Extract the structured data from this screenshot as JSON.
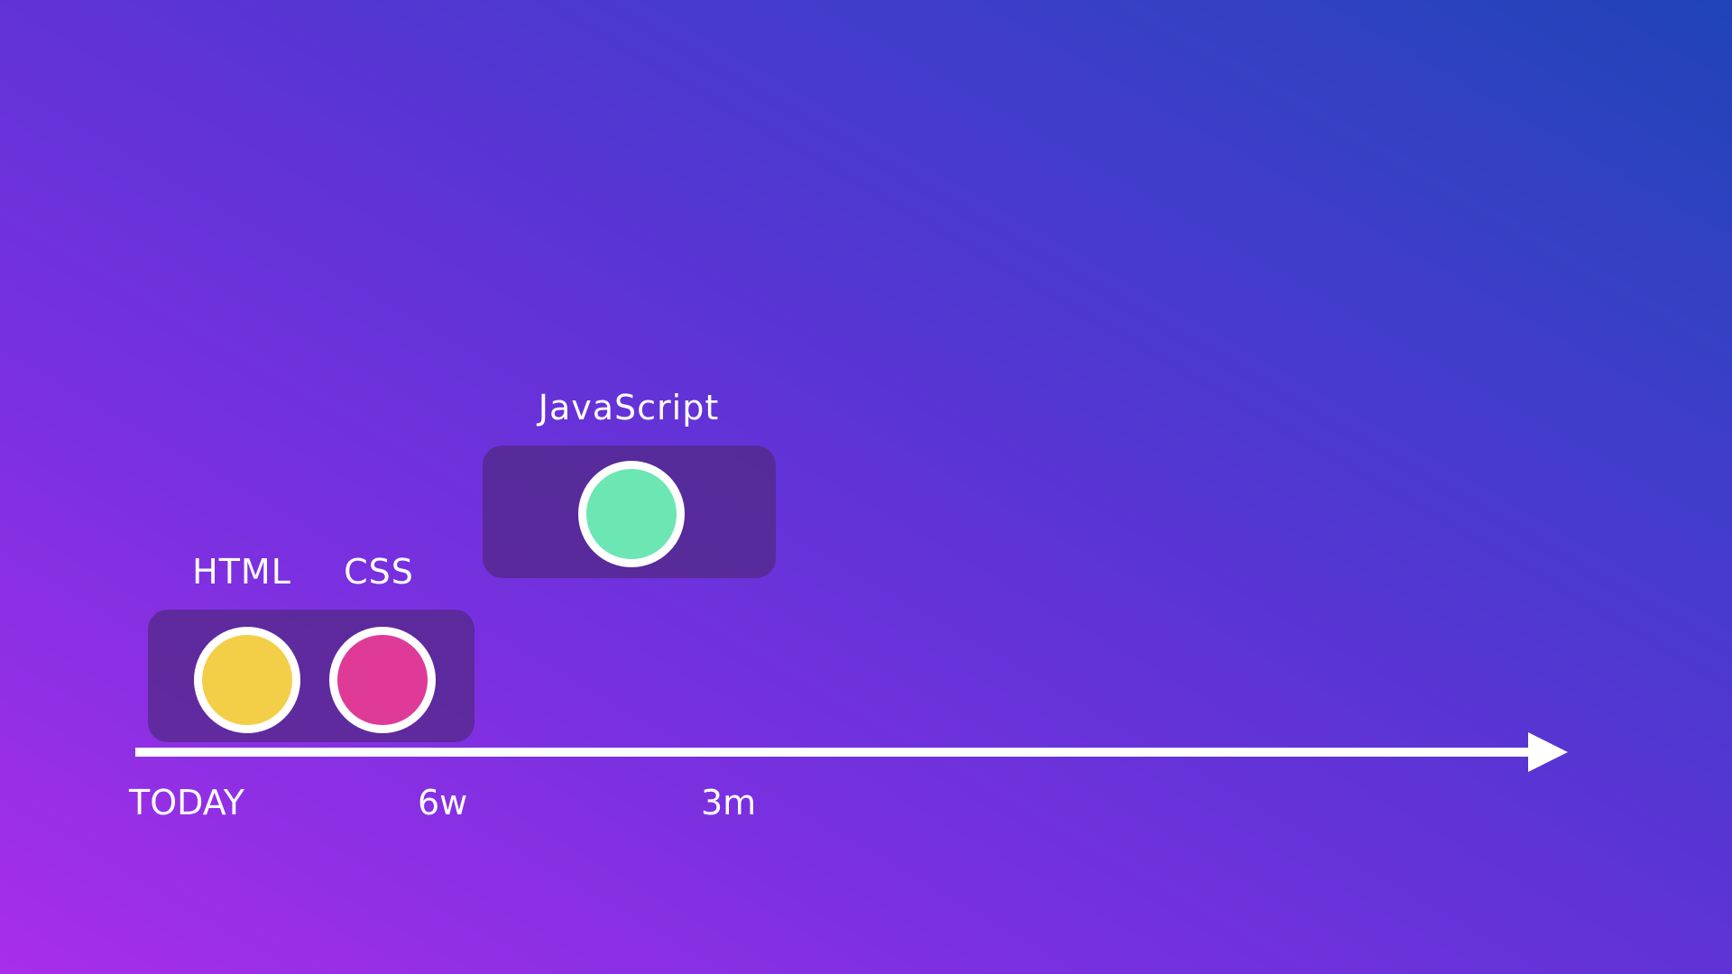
{
  "milestones": [
    {
      "label": "HTML",
      "color": "#f3cf48"
    },
    {
      "label": "CSS",
      "color": "#df3a97"
    },
    {
      "label": "JavaScript",
      "color": "#6ce6b3"
    }
  ],
  "axis": {
    "ticks": [
      "TODAY",
      "6w",
      "3m"
    ],
    "line_color": "#ffffff"
  },
  "colors": {
    "background_start": "#a82eea",
    "background_end": "#1f44b6",
    "group_box": "#502882"
  }
}
